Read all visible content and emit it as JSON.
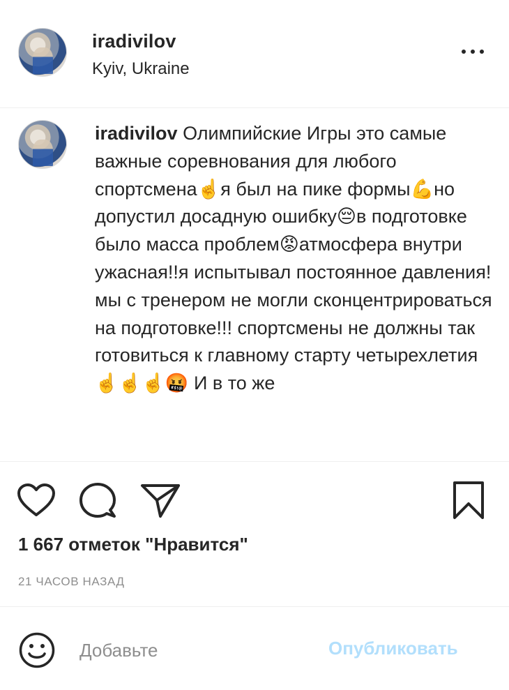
{
  "header": {
    "username": "iradivilov",
    "location": "Kyiv, Ukraine",
    "avatar_icon": "profile-photo",
    "more_icon": "more-horizontal-icon"
  },
  "caption": {
    "username": "iradivilov",
    "text": "Олимпийские Игры это самые важные соревнования для любого спортсмена☝️я был на пике формы💪но допустил досадную ошибку😔в подготовке было масса проблем😡атмосфера внутри ужасная!!я испытывал постоянное давления!мы с тренером не могли сконцентрироваться на подготовке!!! спортсмены не должны так готовиться к главному старту четырехлетия ☝️☝️☝️🤬 И в то же"
  },
  "actions": {
    "like_icon": "heart-icon",
    "comment_icon": "comment-bubble-icon",
    "share_icon": "paper-plane-icon",
    "save_icon": "bookmark-icon",
    "likes_text": "1 667 отметок \"Нравится\"",
    "time_text": "21 ЧАСОВ НАЗАД"
  },
  "add_comment": {
    "emoji_icon": "smiley-icon",
    "placeholder": "Добавьте",
    "publish_label": "Опубликовать",
    "publish_color": "#b2dffc"
  }
}
